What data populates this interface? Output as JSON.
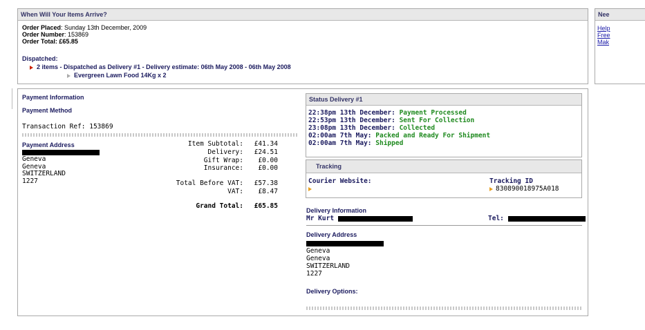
{
  "arrival": {
    "title": "When Will Your Items Arrive?",
    "order_placed_label": "Order Placed",
    "order_placed_value": ": Sunday 13th December, 2009",
    "order_number_label": "Order Number",
    "order_number_value": ": 153869",
    "order_total_label": "Order Total",
    "order_total_value": ": £65.85",
    "dispatched_label": "Dispatched:",
    "dispatch_line": "2 items - Dispatched as Delivery #1 - Delivery estimate: 06th May 2008 - 06th May 2008",
    "item_line": "Evergreen Lawn Food 14Kg x 2"
  },
  "help_panel": {
    "title": "Nee",
    "links": [
      "Help",
      "Free",
      "Mak"
    ]
  },
  "payment": {
    "title": "Payment Information",
    "method_label": "Payment Method",
    "transaction_ref": "Transaction Ref: 153869",
    "address_label": "Payment Address",
    "address_lines": [
      "Geneva",
      "Geneva",
      "SWITZERLAND",
      "1227"
    ],
    "totals": [
      {
        "label": "Item Subtotal:",
        "value": "£41.34"
      },
      {
        "label": "Delivery:",
        "value": "£24.51"
      },
      {
        "label": "Gift Wrap:",
        "value": "£0.00"
      },
      {
        "label": "Insurance:",
        "value": "£0.00"
      }
    ],
    "vat_totals": [
      {
        "label": "Total Before VAT:",
        "value": "£57.38"
      },
      {
        "label": "VAT:",
        "value": "£8.47"
      }
    ],
    "grand_total_label": "Grand Total:",
    "grand_total_value": "£65.85"
  },
  "status": {
    "title": "Status Delivery #1",
    "events": [
      {
        "time": "22:38pm 13th December:",
        "status": "Payment Processed"
      },
      {
        "time": "22:53pm 13th December:",
        "status": "Sent For Collection"
      },
      {
        "time": "23:08pm 13th December:",
        "status": "Collected"
      },
      {
        "time": "02:00am 7th May:",
        "status": "Packed and Ready For Shipment"
      },
      {
        "time": "02:00am 7th May:",
        "status": "Shipped"
      }
    ]
  },
  "tracking": {
    "title": "Tracking",
    "courier_label": "Courier Website:",
    "tracking_id_label": "Tracking ID",
    "tracking_id_value": "830890018975A018"
  },
  "delivery": {
    "info_label": "Delivery Information",
    "name_prefix": "Mr Kurt",
    "tel_label": "Tel:",
    "address_label": "Delivery Address",
    "address_lines": [
      "Geneva",
      "Geneva",
      "SWITZERLAND",
      "1227"
    ],
    "options_label": "Delivery Options:"
  }
}
